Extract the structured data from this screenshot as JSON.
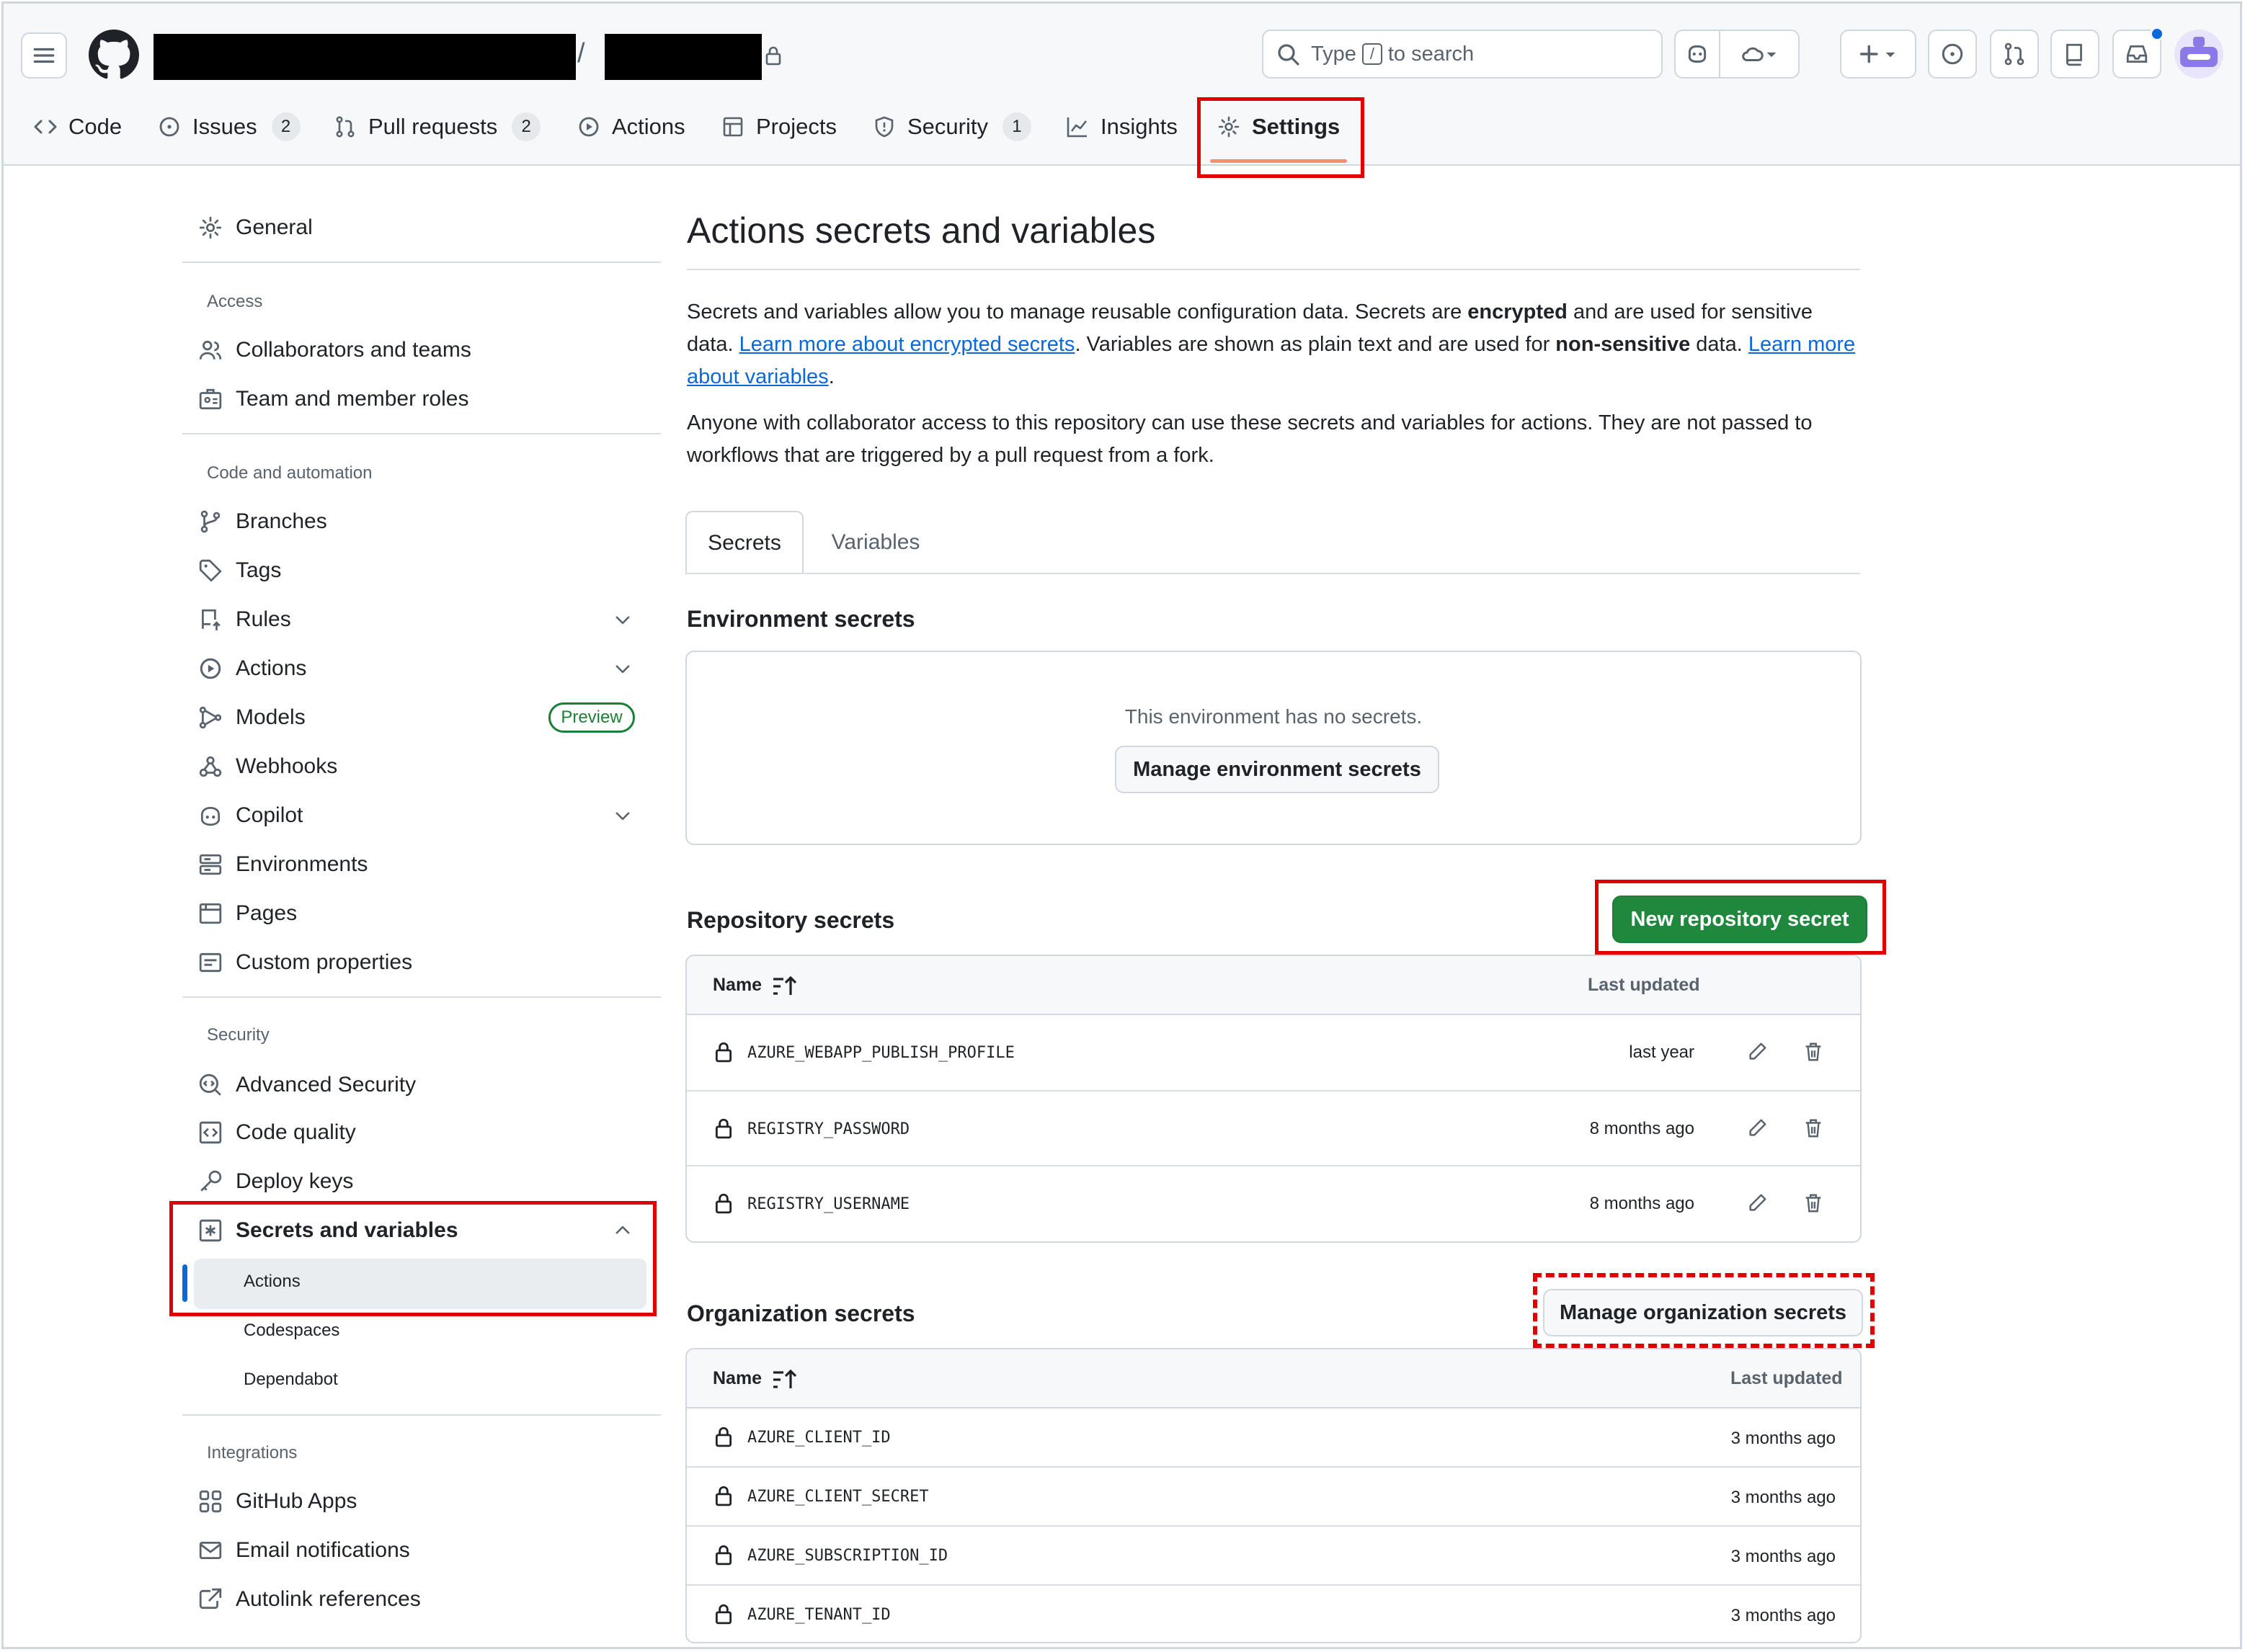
{
  "header": {
    "search_prefix": "Type",
    "search_key": "/",
    "search_suffix": "to search",
    "path_separator": "/"
  },
  "repo_tabs": [
    {
      "label": "Code",
      "icon": "code-icon"
    },
    {
      "label": "Issues",
      "icon": "issue-icon",
      "count": "2"
    },
    {
      "label": "Pull requests",
      "icon": "pull-request-icon",
      "count": "2"
    },
    {
      "label": "Actions",
      "icon": "play-icon"
    },
    {
      "label": "Projects",
      "icon": "table-icon"
    },
    {
      "label": "Security",
      "icon": "shield-icon",
      "count": "1"
    },
    {
      "label": "Insights",
      "icon": "graph-icon"
    },
    {
      "label": "Settings",
      "icon": "gear-icon",
      "selected": true
    }
  ],
  "sidebar": {
    "general": "General",
    "access_heading": "Access",
    "access": [
      "Collaborators and teams",
      "Team and member roles"
    ],
    "code_heading": "Code and automation",
    "code": [
      "Branches",
      "Tags",
      "Rules",
      "Actions",
      "Models",
      "Webhooks",
      "Copilot",
      "Environments",
      "Pages",
      "Custom properties"
    ],
    "preview_badge": "Preview",
    "security_heading": "Security",
    "security": [
      "Advanced Security",
      "Code quality",
      "Deploy keys",
      "Secrets and variables"
    ],
    "secrets_sub": [
      "Actions",
      "Codespaces",
      "Dependabot"
    ],
    "integrations_heading": "Integrations",
    "integrations": [
      "GitHub Apps",
      "Email notifications",
      "Autolink references"
    ]
  },
  "main": {
    "title": "Actions secrets and variables",
    "p1_a": "Secrets and variables allow you to manage reusable configuration data. Secrets are ",
    "p1_b": "encrypted",
    "p1_c": " and are used for sensitive data. ",
    "p1_link1": "Learn more about encrypted secrets",
    "p1_d": ". Variables are shown as plain text and are used for ",
    "p1_e": "non-sensitive",
    "p1_f": " data. ",
    "p1_link2": "Learn more about variables",
    "p1_g": ".",
    "p2": "Anyone with collaborator access to this repository can use these secrets and variables for actions. They are not passed to workflows that are triggered by a pull request from a fork.",
    "tab_secrets": "Secrets",
    "tab_variables": "Variables",
    "env_title": "Environment secrets",
    "env_empty": "This environment has no secrets.",
    "env_button": "Manage environment secrets",
    "repo_title": "Repository secrets",
    "repo_button": "New repository secret",
    "col_name": "Name",
    "col_updated": "Last updated",
    "repo_secrets": [
      {
        "name": "AZURE_WEBAPP_PUBLISH_PROFILE",
        "updated": "last year"
      },
      {
        "name": "REGISTRY_PASSWORD",
        "updated": "8 months ago"
      },
      {
        "name": "REGISTRY_USERNAME",
        "updated": "8 months ago"
      }
    ],
    "org_title": "Organization secrets",
    "org_button": "Manage organization secrets",
    "org_secrets": [
      {
        "name": "AZURE_CLIENT_ID",
        "updated": "3 months ago"
      },
      {
        "name": "AZURE_CLIENT_SECRET",
        "updated": "3 months ago"
      },
      {
        "name": "AZURE_SUBSCRIPTION_ID",
        "updated": "3 months ago"
      },
      {
        "name": "AZURE_TENANT_ID",
        "updated": "3 months ago"
      }
    ]
  },
  "colors": {
    "accent": "#0969da",
    "green": "#1f883d",
    "highlight": "#e00000",
    "underline": "#fd8c73"
  }
}
